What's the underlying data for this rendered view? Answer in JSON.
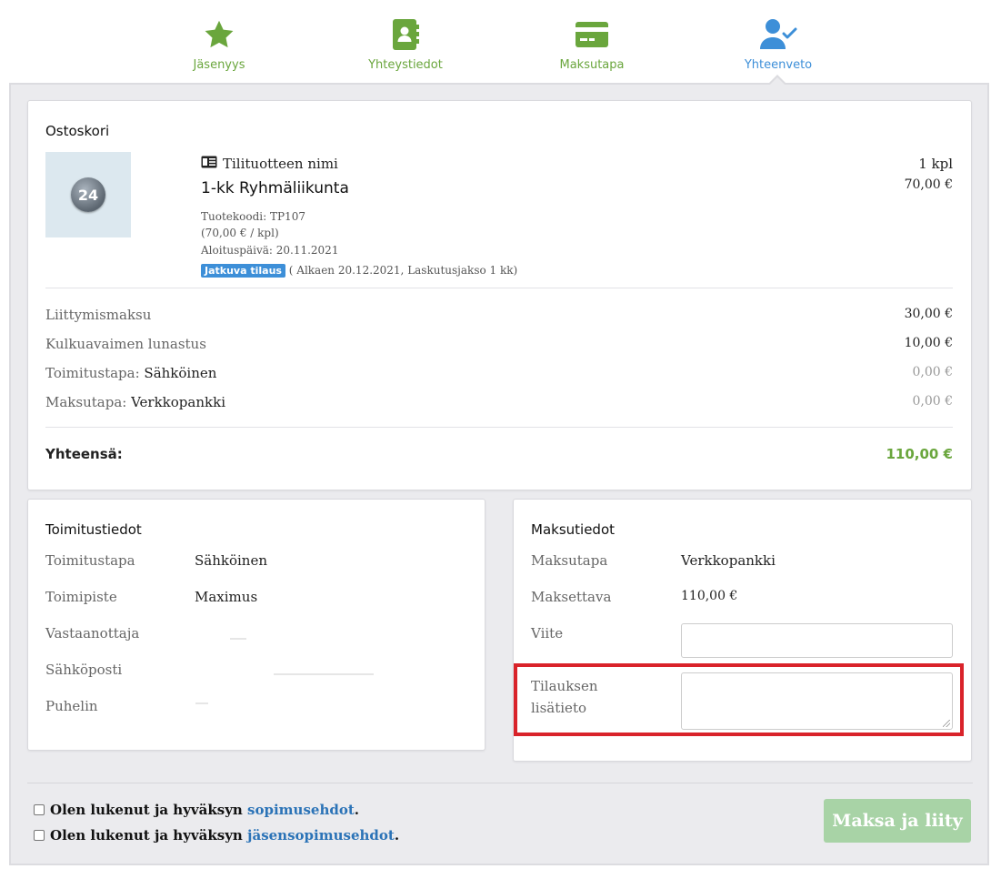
{
  "steps": [
    {
      "label": "Jäsenyys",
      "icon": "star-icon"
    },
    {
      "label": "Yhteystiedot",
      "icon": "contact-book-icon"
    },
    {
      "label": "Maksutapa",
      "icon": "credit-card-icon"
    },
    {
      "label": "Yhteenveto",
      "icon": "user-check-icon"
    }
  ],
  "cart": {
    "title": "Ostoskori",
    "thumb_text": "24",
    "product_type": "Tilituotteen nimi",
    "product_name": "1-kk Ryhmäliikunta",
    "product_code": "Tuotekoodi: TP107",
    "unit_price": "(70,00 € / kpl)",
    "start_date": "Aloituspäivä: 20.11.2021",
    "subscription_badge": "Jatkuva tilaus",
    "subscription_info": "( Alkaen 20.12.2021, Laskutusjakso 1 kk)",
    "quantity": "1 kpl",
    "price": "70,00 €",
    "lines": [
      {
        "label": "Liittymismaksu",
        "value_label": "",
        "amount": "30,00 €"
      },
      {
        "label": "Kulkuavaimen lunastus",
        "value_label": "",
        "amount": "10,00 €"
      },
      {
        "label": "Toimitustapa: ",
        "value_label": "Sähköinen",
        "amount": "0,00 €"
      },
      {
        "label": "Maksutapa: ",
        "value_label": "Verkkopankki",
        "amount": "0,00 €"
      }
    ],
    "total_label": "Yhteensä:",
    "total_amount": "110,00 €"
  },
  "shipping": {
    "title": "Toimitustiedot",
    "rows": [
      {
        "key": "Toimitustapa",
        "value": "Sähköinen"
      },
      {
        "key": "Toimipiste",
        "value": "Maximus"
      },
      {
        "key": "Vastaanottaja",
        "value": ""
      },
      {
        "key": "Sähköposti",
        "value": ""
      },
      {
        "key": "Puhelin",
        "value": ""
      }
    ]
  },
  "payment": {
    "title": "Maksutiedot",
    "rows": [
      {
        "key": "Maksutapa",
        "value": "Verkkopankki"
      },
      {
        "key": "Maksettava",
        "value": "110,00 €"
      }
    ],
    "reference_label": "Viite",
    "reference_value": "",
    "notes_label_1": "Tilauksen",
    "notes_label_2": "lisätieto",
    "notes_value": ""
  },
  "footer": {
    "terms1_prefix": "Olen lukenut ja hyväksyn ",
    "terms1_link": "sopimusehdot",
    "terms2_prefix": "Olen lukenut ja hyväksyn ",
    "terms2_link": "jäsensopimusehdot",
    "suffix": ".",
    "pay_button": "Maksa ja liity"
  },
  "colors": {
    "step_green": "#6aa63d",
    "step_active_blue": "#3d8fd8",
    "total_green": "#6aa63d",
    "link_blue": "#2b73b7",
    "highlight_red": "#d9232a",
    "pay_button_bg": "#a8d3a6"
  }
}
